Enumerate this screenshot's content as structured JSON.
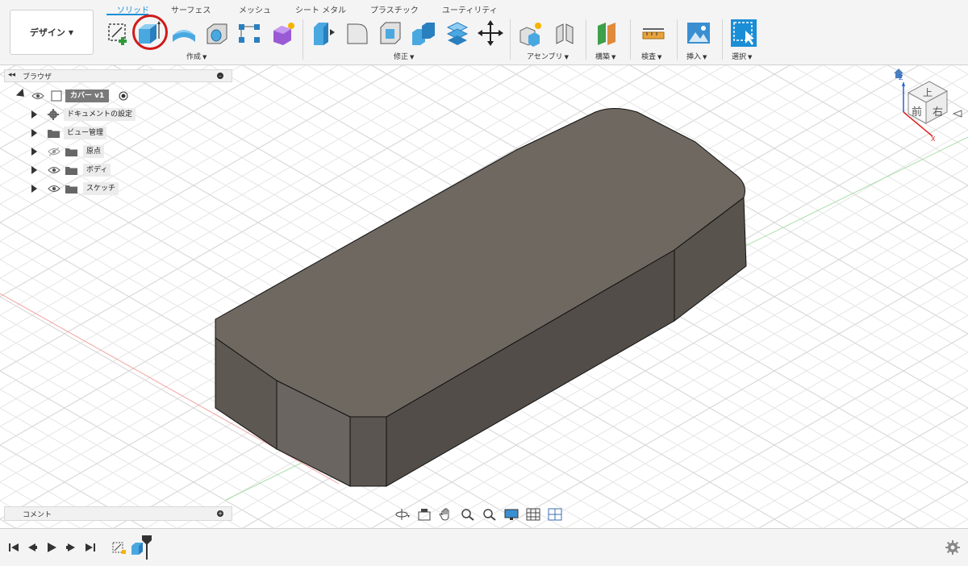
{
  "workspace": {
    "label": "デザイン"
  },
  "tabs": [
    {
      "label": "ソリッド",
      "active": true
    },
    {
      "label": "サーフェス",
      "active": false
    },
    {
      "label": "メッシュ",
      "active": false
    },
    {
      "label": "シート メタル",
      "active": false
    },
    {
      "label": "プラスチック",
      "active": false
    },
    {
      "label": "ユーティリティ",
      "active": false
    }
  ],
  "groups": {
    "create": "作成",
    "modify": "修正",
    "assemble": "アセンブリ",
    "construct": "構築",
    "inspect": "検査",
    "insert": "挿入",
    "select": "選択"
  },
  "browser": {
    "title": "ブラウザ",
    "root": "カバー v1",
    "items": [
      {
        "label": "ドキュメントの設定",
        "icon": "gear-icon",
        "eye": "none"
      },
      {
        "label": "ビュー管理",
        "icon": "folder-icon",
        "eye": "none"
      },
      {
        "label": "原点",
        "icon": "folder-icon",
        "eye": "hidden"
      },
      {
        "label": "ボディ",
        "icon": "folder-icon",
        "eye": "visible"
      },
      {
        "label": "スケッチ",
        "icon": "folder-icon",
        "eye": "visible"
      }
    ]
  },
  "comments": {
    "title": "コメント"
  },
  "viewcube": {
    "top": "上",
    "front": "前",
    "right": "右"
  },
  "colors": {
    "accent": "#1a8ed6",
    "highlight": "#d01a1a",
    "body_top": "#6e6860",
    "body_side": "#58534d"
  }
}
